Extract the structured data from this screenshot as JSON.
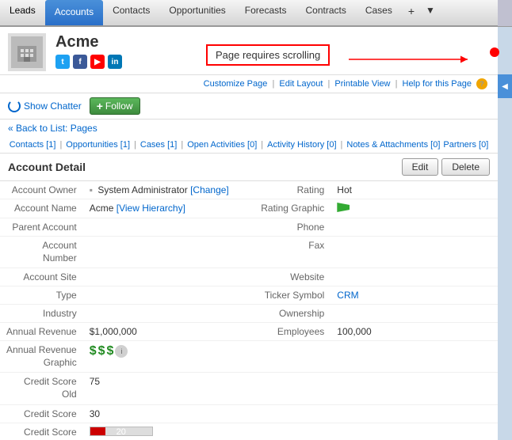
{
  "nav": {
    "items": [
      {
        "label": "Leads",
        "active": false
      },
      {
        "label": "Accounts",
        "active": true
      },
      {
        "label": "Contacts",
        "active": false
      },
      {
        "label": "Opportunities",
        "active": false
      },
      {
        "label": "Forecasts",
        "active": false
      },
      {
        "label": "Contracts",
        "active": false
      },
      {
        "label": "Cases",
        "active": false
      }
    ],
    "plus_label": "+",
    "arrow_label": "▼"
  },
  "page_scroll_note": "Page requires scrolling",
  "account": {
    "name": "Acme"
  },
  "top_links": {
    "customize": "Customize Page",
    "edit_layout": "Edit Layout",
    "printable": "Printable View",
    "help": "Help for this Page"
  },
  "chatter": {
    "show_label": "Show Chatter",
    "follow_label": "Follow"
  },
  "back_to_list": "« Back to List: Pages",
  "sub_links": [
    {
      "label": "Contacts",
      "count": "[1]"
    },
    {
      "label": "Opportunities",
      "count": "[1]"
    },
    {
      "label": "Cases",
      "count": "[1]"
    },
    {
      "label": "Open Activities",
      "count": "[0]"
    },
    {
      "label": "Activity History",
      "count": "[0]"
    },
    {
      "label": "Notes & Attachments",
      "count": "[0]"
    },
    {
      "label": "Partners",
      "count": "[0]"
    }
  ],
  "section": {
    "title": "Account Detail",
    "edit_btn": "Edit",
    "delete_btn": "Delete"
  },
  "fields": {
    "left": [
      {
        "label": "Account Owner",
        "value": "System Administrator",
        "link": "[Change]",
        "has_icon": true
      },
      {
        "label": "Account Name",
        "value": "Acme",
        "link": "[View Hierarchy]"
      },
      {
        "label": "Parent Account",
        "value": ""
      },
      {
        "label": "Account Number",
        "value": ""
      },
      {
        "label": "Account Site",
        "value": ""
      },
      {
        "label": "Type",
        "value": ""
      },
      {
        "label": "Industry",
        "value": ""
      },
      {
        "label": "Annual Revenue",
        "value": "$1,000,000"
      },
      {
        "label": "Annual Revenue Graphic",
        "value": "",
        "is_money_graphic": true
      },
      {
        "label": "Credit Score Old",
        "value": "75"
      },
      {
        "label": "Credit Score",
        "value": "30"
      },
      {
        "label": "Credit Score",
        "value": "",
        "is_bar": true
      }
    ],
    "right": [
      {
        "label": "Rating",
        "value": "Hot"
      },
      {
        "label": "Rating Graphic",
        "value": "",
        "is_flag": true
      },
      {
        "label": "Phone",
        "value": ""
      },
      {
        "label": "Fax",
        "value": ""
      },
      {
        "label": "Website",
        "value": ""
      },
      {
        "label": "Ticker Symbol",
        "value": "CRM",
        "is_link": true
      },
      {
        "label": "Ownership",
        "value": ""
      },
      {
        "label": "Employees",
        "value": "100,000"
      }
    ]
  },
  "credit_bar": {
    "value": "20",
    "fill_pct": 25
  }
}
